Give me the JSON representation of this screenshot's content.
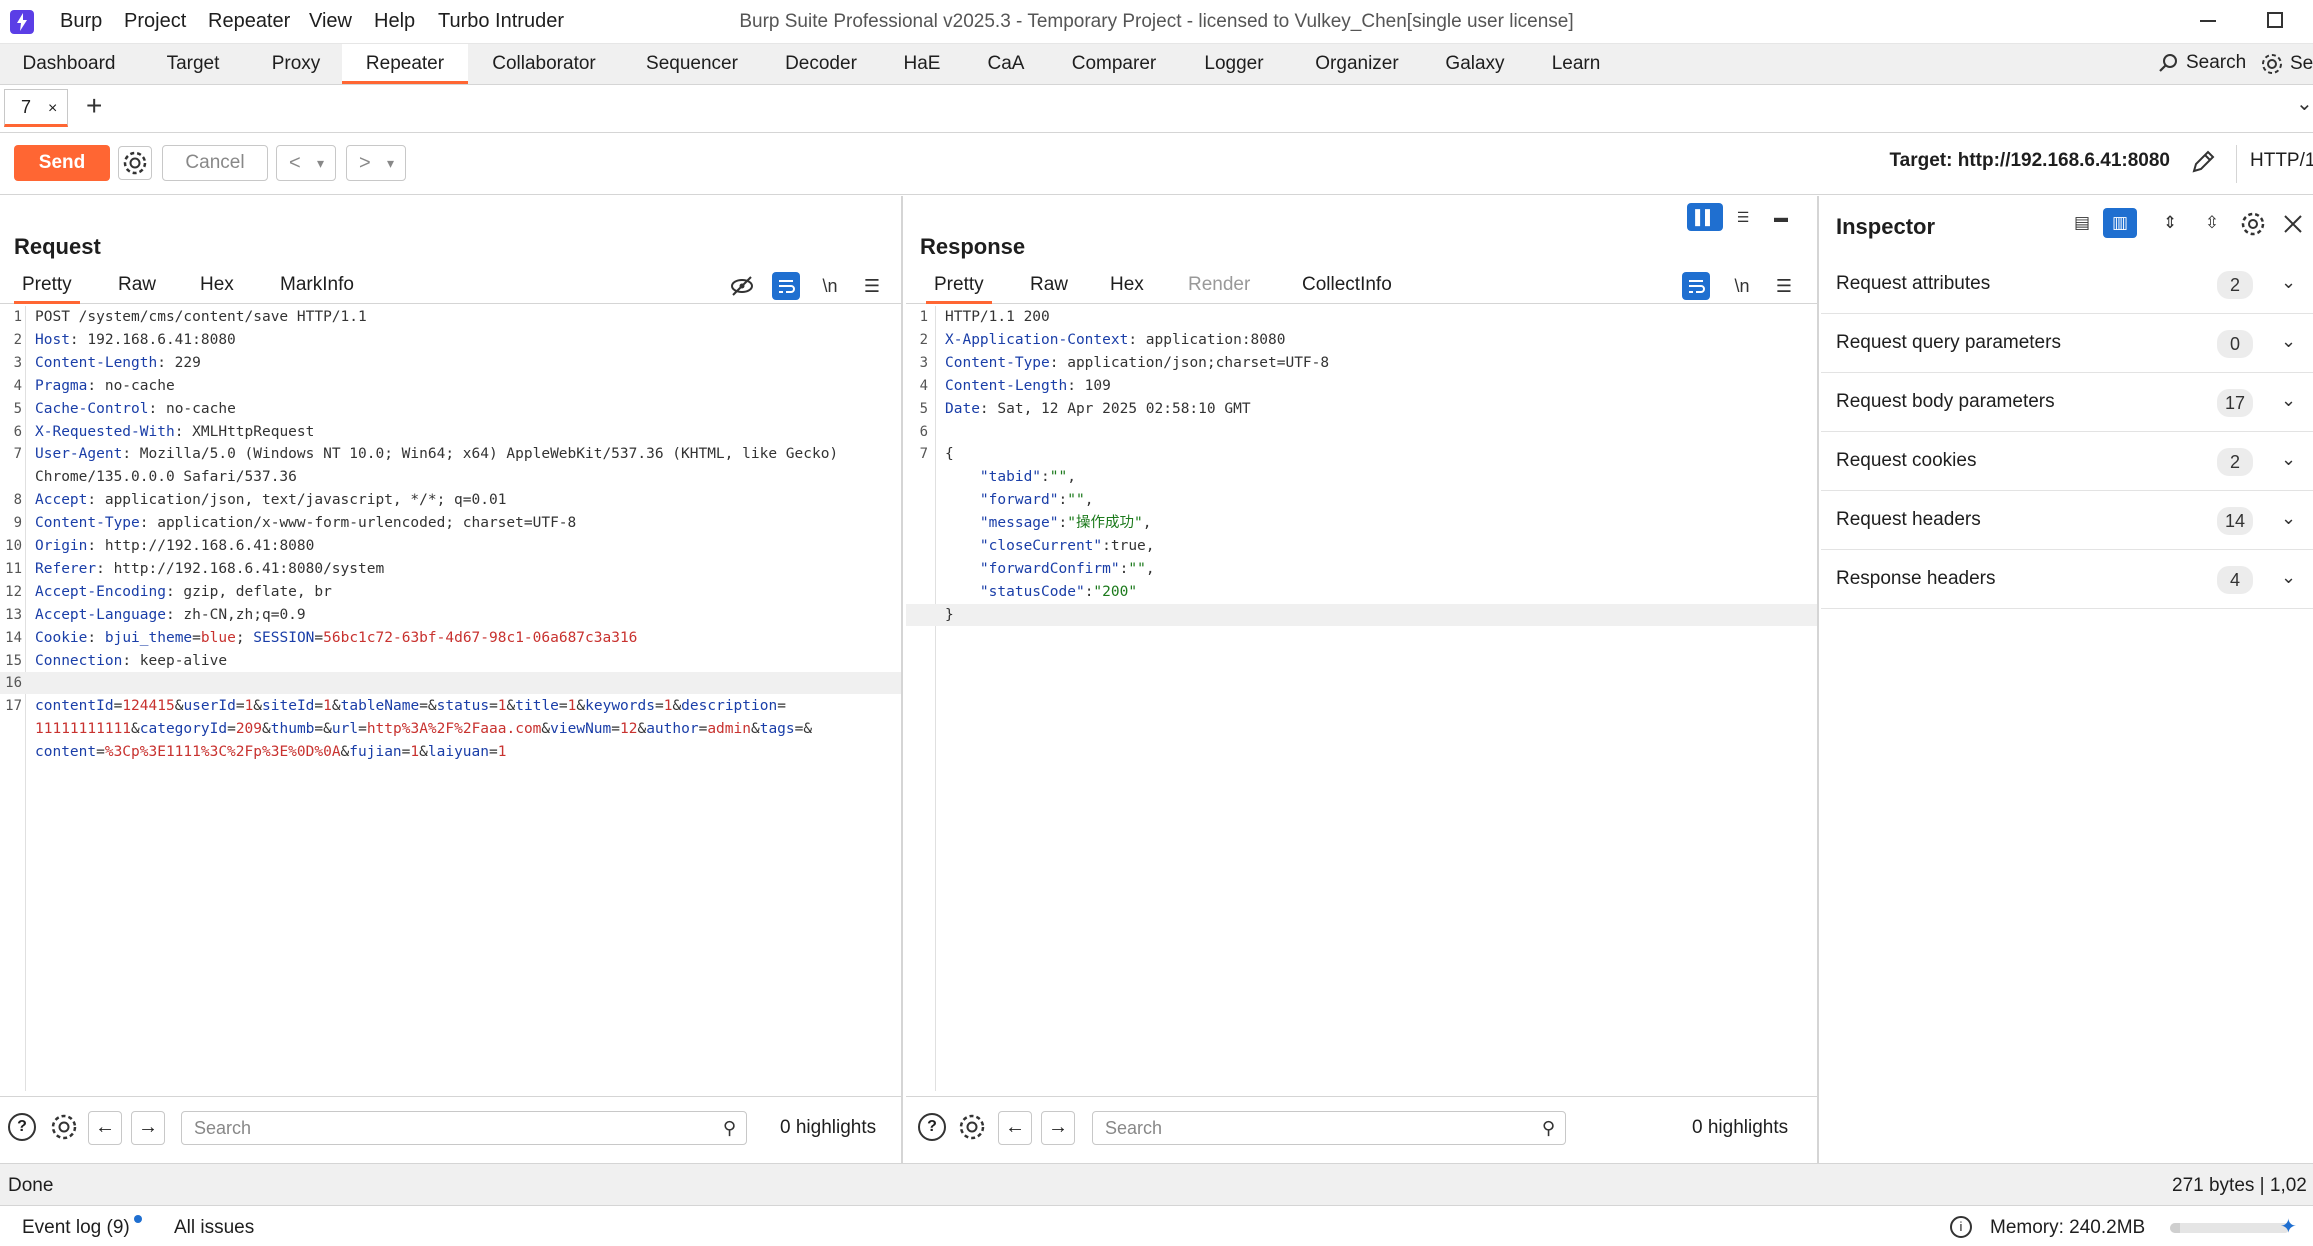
{
  "window": {
    "title": "Burp Suite Professional v2025.3 - Temporary Project - licensed to Vulkey_Chen[single user license]",
    "menu": [
      "Burp",
      "Project",
      "Repeater",
      "View",
      "Help",
      "Turbo Intruder"
    ]
  },
  "main_tabs": {
    "items": [
      "Dashboard",
      "Target",
      "Proxy",
      "Repeater",
      "Collaborator",
      "Sequencer",
      "Decoder",
      "HaE",
      "CaA",
      "Comparer",
      "Logger",
      "Organizer",
      "Galaxy",
      "Learn"
    ],
    "active": "Repeater",
    "search_label": "Search",
    "settings_label": "Se"
  },
  "repeater_tabs": {
    "tab_label": "7",
    "close_glyph": "×",
    "add_glyph": "+"
  },
  "toolbar": {
    "send_label": "Send",
    "cancel_label": "Cancel",
    "back_glyph": "<",
    "forward_glyph": ">",
    "dropdown_glyph": "▾",
    "target_label": "Target: http://192.168.6.41:8080",
    "http_version": "HTTP/1"
  },
  "request": {
    "title": "Request",
    "tabs": [
      "Pretty",
      "Raw",
      "Hex",
      "MarkInfo"
    ],
    "active_tab": "Pretty",
    "lines": [
      {
        "n": "1",
        "parts": [
          [
            "",
            "POST /system/cms/content/save HTTP/1.1"
          ]
        ]
      },
      {
        "n": "2",
        "parts": [
          [
            "hk",
            "Host"
          ],
          [
            "hv",
            ": 192.168.6.41:8080"
          ]
        ]
      },
      {
        "n": "3",
        "parts": [
          [
            "hk",
            "Content-Length"
          ],
          [
            "hv",
            ": 229"
          ]
        ]
      },
      {
        "n": "4",
        "parts": [
          [
            "hk",
            "Pragma"
          ],
          [
            "hv",
            ": no-cache"
          ]
        ]
      },
      {
        "n": "5",
        "parts": [
          [
            "hk",
            "Cache-Control"
          ],
          [
            "hv",
            ": no-cache"
          ]
        ]
      },
      {
        "n": "6",
        "parts": [
          [
            "hk",
            "X-Requested-With"
          ],
          [
            "hv",
            ": XMLHttpRequest"
          ]
        ]
      },
      {
        "n": "7",
        "parts": [
          [
            "hk",
            "User-Agent"
          ],
          [
            "hv",
            ": Mozilla/5.0 (Windows NT 10.0; Win64; x64) AppleWebKit/537.36 (KHTML, like Gecko)"
          ]
        ]
      },
      {
        "n": "",
        "parts": [
          [
            "hv",
            "Chrome/135.0.0.0 Safari/537.36"
          ]
        ]
      },
      {
        "n": "8",
        "parts": [
          [
            "hk",
            "Accept"
          ],
          [
            "hv",
            ": application/json, text/javascript, */*; q=0.01"
          ]
        ]
      },
      {
        "n": "9",
        "parts": [
          [
            "hk",
            "Content-Type"
          ],
          [
            "hv",
            ": application/x-www-form-urlencoded; charset=UTF-8"
          ]
        ]
      },
      {
        "n": "10",
        "parts": [
          [
            "hk",
            "Origin"
          ],
          [
            "hv",
            ": http://192.168.6.41:8080"
          ]
        ]
      },
      {
        "n": "11",
        "parts": [
          [
            "hk",
            "Referer"
          ],
          [
            "hv",
            ": http://192.168.6.41:8080/system"
          ]
        ]
      },
      {
        "n": "12",
        "parts": [
          [
            "hk",
            "Accept-Encoding"
          ],
          [
            "hv",
            ": gzip, deflate, br"
          ]
        ]
      },
      {
        "n": "13",
        "parts": [
          [
            "hk",
            "Accept-Language"
          ],
          [
            "hv",
            ": zh-CN,zh;q=0.9"
          ]
        ]
      },
      {
        "n": "14",
        "parts": [
          [
            "hk",
            "Cookie"
          ],
          [
            "hv",
            ": "
          ],
          [
            "pk",
            "bjui_theme"
          ],
          [
            "hv",
            "="
          ],
          [
            "pv",
            "blue"
          ],
          [
            "hv",
            "; "
          ],
          [
            "pk",
            "SESSION"
          ],
          [
            "hv",
            "="
          ],
          [
            "pv",
            "56bc1c72-63bf-4d67-98c1-06a687c3a316"
          ]
        ]
      },
      {
        "n": "15",
        "parts": [
          [
            "hk",
            "Connection"
          ],
          [
            "hv",
            ": keep-alive"
          ]
        ]
      },
      {
        "n": "16",
        "parts": [
          [
            "",
            ""
          ]
        ],
        "cursor": true
      },
      {
        "n": "17",
        "parts": [
          [
            "pk",
            "contentId"
          ],
          [
            "hv",
            "="
          ],
          [
            "pv",
            "124415"
          ],
          [
            "hv",
            "&"
          ],
          [
            "pk",
            "userId"
          ],
          [
            "hv",
            "="
          ],
          [
            "pv",
            "1"
          ],
          [
            "hv",
            "&"
          ],
          [
            "pk",
            "siteId"
          ],
          [
            "hv",
            "="
          ],
          [
            "pv",
            "1"
          ],
          [
            "hv",
            "&"
          ],
          [
            "pk",
            "tableName"
          ],
          [
            "hv",
            "=&"
          ],
          [
            "pk",
            "status"
          ],
          [
            "hv",
            "="
          ],
          [
            "pv",
            "1"
          ],
          [
            "hv",
            "&"
          ],
          [
            "pk",
            "title"
          ],
          [
            "hv",
            "="
          ],
          [
            "pv",
            "1"
          ],
          [
            "hv",
            "&"
          ],
          [
            "pk",
            "keywords"
          ],
          [
            "hv",
            "="
          ],
          [
            "pv",
            "1"
          ],
          [
            "hv",
            "&"
          ],
          [
            "pk",
            "description"
          ],
          [
            "hv",
            "="
          ]
        ]
      },
      {
        "n": "",
        "parts": [
          [
            "pv",
            "11111111111"
          ],
          [
            "hv",
            "&"
          ],
          [
            "pk",
            "categoryId"
          ],
          [
            "hv",
            "="
          ],
          [
            "pv",
            "209"
          ],
          [
            "hv",
            "&"
          ],
          [
            "pk",
            "thumb"
          ],
          [
            "hv",
            "=&"
          ],
          [
            "pk",
            "url"
          ],
          [
            "hv",
            "="
          ],
          [
            "pv",
            "http%3A%2F%2Faaa.com"
          ],
          [
            "hv",
            "&"
          ],
          [
            "pk",
            "viewNum"
          ],
          [
            "hv",
            "="
          ],
          [
            "pv",
            "12"
          ],
          [
            "hv",
            "&"
          ],
          [
            "pk",
            "author"
          ],
          [
            "hv",
            "="
          ],
          [
            "pv",
            "admin"
          ],
          [
            "hv",
            "&"
          ],
          [
            "pk",
            "tags"
          ],
          [
            "hv",
            "=&"
          ]
        ]
      },
      {
        "n": "",
        "parts": [
          [
            "pk",
            "content"
          ],
          [
            "hv",
            "="
          ],
          [
            "pv",
            "%3Cp%3E1111%3C%2Fp%3E%0D%0A"
          ],
          [
            "hv",
            "&"
          ],
          [
            "pk",
            "fujian"
          ],
          [
            "hv",
            "="
          ],
          [
            "pv",
            "1"
          ],
          [
            "hv",
            "&"
          ],
          [
            "pk",
            "laiyuan"
          ],
          [
            "hv",
            "="
          ],
          [
            "pv",
            "1"
          ]
        ]
      }
    ],
    "search_placeholder": "Search",
    "highlights": "0 highlights"
  },
  "response": {
    "title": "Response",
    "tabs": [
      "Pretty",
      "Raw",
      "Hex",
      "Render",
      "CollectInfo"
    ],
    "active_tab": "Pretty",
    "lines": [
      {
        "n": "1",
        "parts": [
          [
            "",
            "HTTP/1.1 200"
          ]
        ]
      },
      {
        "n": "2",
        "parts": [
          [
            "hk",
            "X-Application-Context"
          ],
          [
            "hv",
            ": application:8080"
          ]
        ]
      },
      {
        "n": "3",
        "parts": [
          [
            "hk",
            "Content-Type"
          ],
          [
            "hv",
            ": application/json;charset=UTF-8"
          ]
        ]
      },
      {
        "n": "4",
        "parts": [
          [
            "hk",
            "Content-Length"
          ],
          [
            "hv",
            ": 109"
          ]
        ]
      },
      {
        "n": "5",
        "parts": [
          [
            "hk",
            "Date"
          ],
          [
            "hv",
            ": Sat, 12 Apr 2025 02:58:10 GMT"
          ]
        ]
      },
      {
        "n": "6",
        "parts": [
          [
            "",
            ""
          ]
        ]
      },
      {
        "n": "7",
        "parts": [
          [
            "",
            "{"
          ]
        ]
      },
      {
        "n": "",
        "parts": [
          [
            "",
            "    "
          ],
          [
            "js",
            "\"tabid\""
          ],
          [
            "hv",
            ":"
          ],
          [
            "jv",
            "\"\""
          ],
          [
            "hv",
            ","
          ]
        ]
      },
      {
        "n": "",
        "parts": [
          [
            "",
            "    "
          ],
          [
            "js",
            "\"forward\""
          ],
          [
            "hv",
            ":"
          ],
          [
            "jv",
            "\"\""
          ],
          [
            "hv",
            ","
          ]
        ]
      },
      {
        "n": "",
        "parts": [
          [
            "",
            "    "
          ],
          [
            "js",
            "\"message\""
          ],
          [
            "hv",
            ":"
          ],
          [
            "jv",
            "\"操作成功\""
          ],
          [
            "hv",
            ","
          ]
        ]
      },
      {
        "n": "",
        "parts": [
          [
            "",
            "    "
          ],
          [
            "js",
            "\"closeCurrent\""
          ],
          [
            "hv",
            ":true,"
          ]
        ]
      },
      {
        "n": "",
        "parts": [
          [
            "",
            "    "
          ],
          [
            "js",
            "\"forwardConfirm\""
          ],
          [
            "hv",
            ":"
          ],
          [
            "jv",
            "\"\""
          ],
          [
            "hv",
            ","
          ]
        ]
      },
      {
        "n": "",
        "parts": [
          [
            "",
            "    "
          ],
          [
            "js",
            "\"statusCode\""
          ],
          [
            "hv",
            ":"
          ],
          [
            "jv",
            "\"200\""
          ]
        ]
      },
      {
        "n": "",
        "parts": [
          [
            "",
            "}"
          ]
        ],
        "cursor": true
      }
    ],
    "search_placeholder": "Search",
    "highlights": "0 highlights"
  },
  "inspector": {
    "title": "Inspector",
    "sections": [
      {
        "label": "Request attributes",
        "count": "2"
      },
      {
        "label": "Request query parameters",
        "count": "0"
      },
      {
        "label": "Request body parameters",
        "count": "17"
      },
      {
        "label": "Request cookies",
        "count": "2"
      },
      {
        "label": "Request headers",
        "count": "14"
      },
      {
        "label": "Response headers",
        "count": "4"
      }
    ]
  },
  "status": {
    "text": "Done",
    "response_stats": "271 bytes | 1,02"
  },
  "bottom": {
    "event_log": "Event log (9)",
    "all_issues": "All issues",
    "memory": "Memory: 240.2MB",
    "memory_fraction": 0.08
  },
  "colors": {
    "accent": "#ff6633",
    "toggle_blue": "#1f6fd0",
    "header_key": "#1a3ea8",
    "param_value": "#c8322f",
    "json_string": "#1c7a1c"
  }
}
